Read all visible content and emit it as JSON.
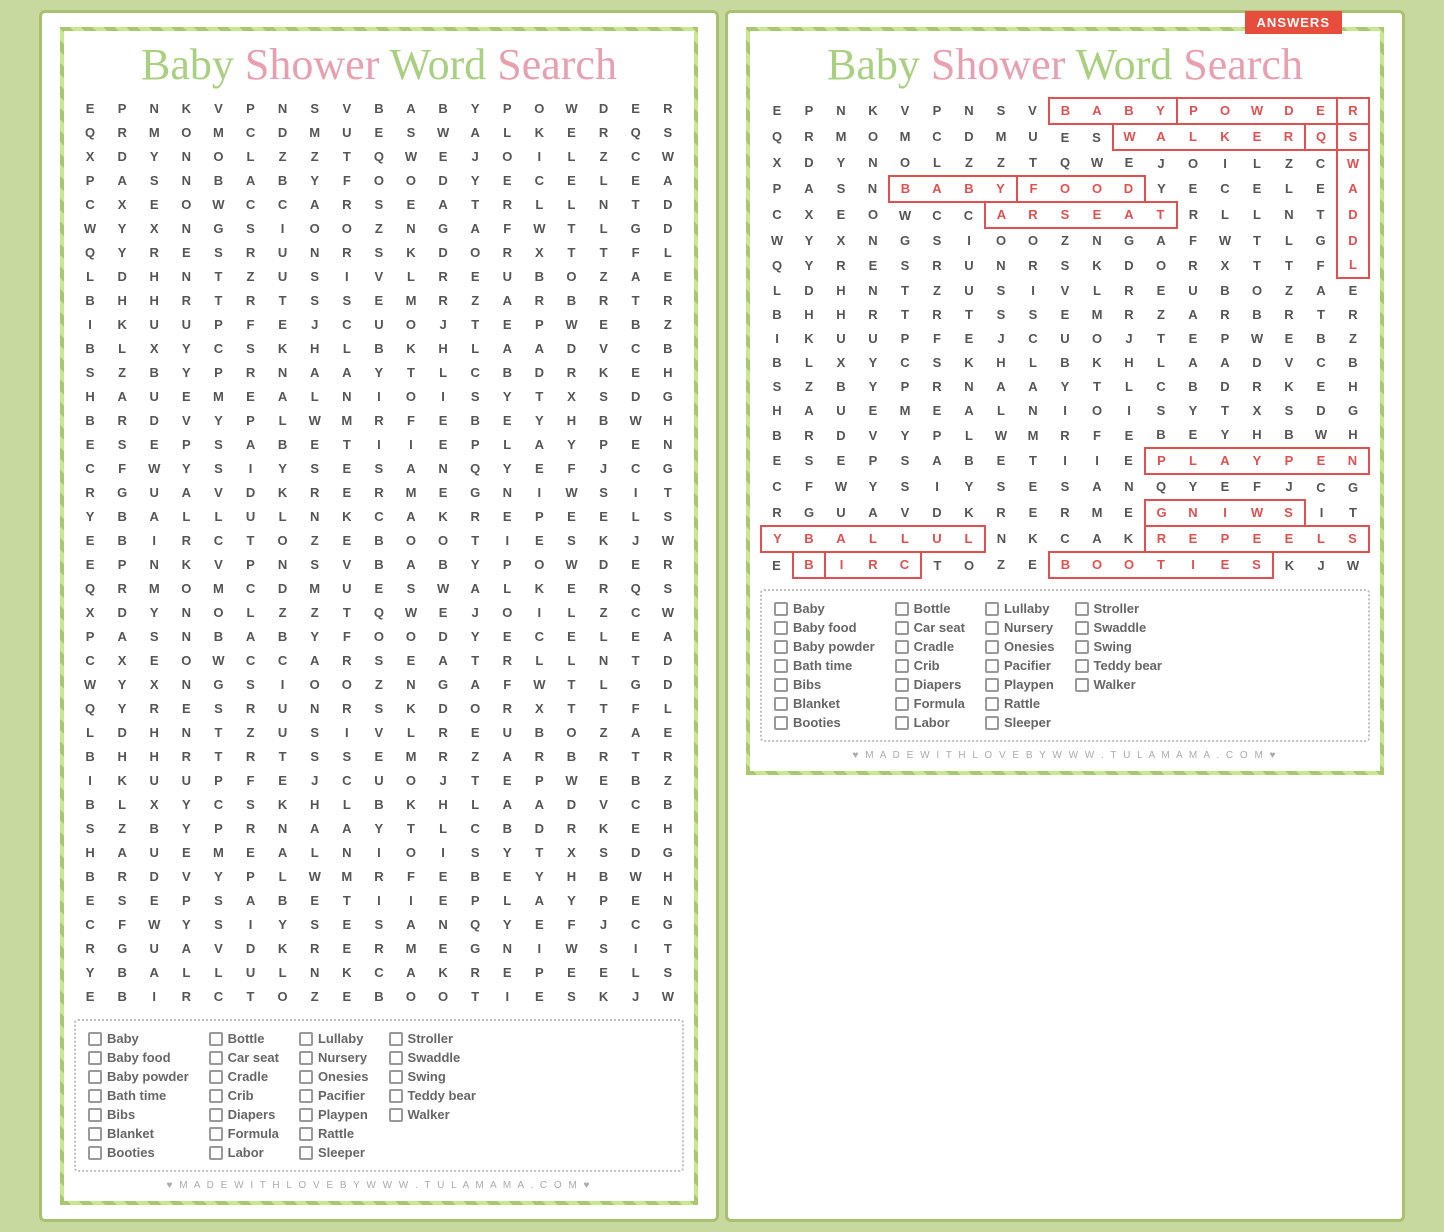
{
  "left_card": {
    "title": "Baby Shower Word Search",
    "footer": "♥  M A D E   W I T H   L O V E   B Y   W W W . T U L A M A M A . C O M  ♥",
    "grid": [
      [
        "E",
        "P",
        "N",
        "K",
        "V",
        "P",
        "N",
        "S",
        "V",
        "B",
        "A",
        "B",
        "Y",
        "P",
        "O",
        "W",
        "D",
        "E",
        "R"
      ],
      [
        "Q",
        "R",
        "M",
        "O",
        "M",
        "C",
        "D",
        "M",
        "U",
        "E",
        "S",
        "W",
        "A",
        "L",
        "K",
        "E",
        "R",
        "Q",
        "S"
      ],
      [
        "X",
        "D",
        "Y",
        "N",
        "O",
        "L",
        "Z",
        "Z",
        "T",
        "Q",
        "W",
        "E",
        "J",
        "O",
        "I",
        "L",
        "Z",
        "C",
        "W"
      ],
      [
        "P",
        "A",
        "S",
        "N",
        "B",
        "A",
        "B",
        "Y",
        "F",
        "O",
        "O",
        "D",
        "Y",
        "E",
        "C",
        "E",
        "L",
        "E",
        "A"
      ],
      [
        "C",
        "X",
        "E",
        "O",
        "W",
        "C",
        "C",
        "A",
        "R",
        "S",
        "E",
        "A",
        "T",
        "R",
        "L",
        "L",
        "N",
        "T",
        "D"
      ],
      [
        "W",
        "Y",
        "X",
        "N",
        "G",
        "S",
        "I",
        "O",
        "O",
        "Z",
        "N",
        "G",
        "A",
        "F",
        "W",
        "T",
        "L",
        "G",
        "D"
      ],
      [
        "Q",
        "Y",
        "R",
        "E",
        "S",
        "R",
        "U",
        "N",
        "R",
        "S",
        "K",
        "D",
        "O",
        "R",
        "X",
        "T",
        "T",
        "F",
        "L"
      ],
      [
        "L",
        "D",
        "H",
        "N",
        "T",
        "Z",
        "U",
        "S",
        "I",
        "V",
        "L",
        "R",
        "E",
        "U",
        "B",
        "O",
        "Z",
        "A",
        "E"
      ],
      [
        "B",
        "H",
        "H",
        "R",
        "T",
        "R",
        "T",
        "S",
        "S",
        "E",
        "M",
        "R",
        "Z",
        "A",
        "R",
        "B",
        "R",
        "T",
        "R"
      ],
      [
        "I",
        "K",
        "U",
        "U",
        "P",
        "F",
        "E",
        "J",
        "C",
        "U",
        "O",
        "J",
        "T",
        "E",
        "P",
        "W",
        "E",
        "B",
        "Z"
      ],
      [
        "B",
        "L",
        "X",
        "Y",
        "C",
        "S",
        "K",
        "H",
        "L",
        "B",
        "K",
        "H",
        "L",
        "A",
        "A",
        "D",
        "V",
        "C",
        "B"
      ],
      [
        "S",
        "Z",
        "B",
        "Y",
        "P",
        "R",
        "N",
        "A",
        "A",
        "Y",
        "T",
        "L",
        "C",
        "B",
        "D",
        "R",
        "K",
        "E",
        "H"
      ],
      [
        "H",
        "A",
        "U",
        "E",
        "M",
        "E",
        "A",
        "L",
        "N",
        "I",
        "O",
        "I",
        "S",
        "Y",
        "T",
        "X",
        "S",
        "D",
        "G"
      ],
      [
        "B",
        "R",
        "D",
        "V",
        "Y",
        "P",
        "L",
        "W",
        "M",
        "R",
        "F",
        "E",
        "B",
        "E",
        "Y",
        "H",
        "B",
        "W",
        "H"
      ],
      [
        "E",
        "S",
        "E",
        "P",
        "S",
        "A",
        "B",
        "E",
        "T",
        "I",
        "I",
        "E",
        "P",
        "L",
        "A",
        "Y",
        "P",
        "E",
        "N"
      ],
      [
        "C",
        "F",
        "W",
        "Y",
        "S",
        "I",
        "Y",
        "S",
        "E",
        "S",
        "A",
        "N",
        "Q",
        "Y",
        "E",
        "F",
        "J",
        "C",
        "G"
      ],
      [
        "R",
        "G",
        "U",
        "A",
        "V",
        "D",
        "K",
        "R",
        "E",
        "R",
        "M",
        "E",
        "G",
        "N",
        "I",
        "W",
        "S",
        "I",
        "T"
      ],
      [
        "Y",
        "B",
        "A",
        "L",
        "L",
        "U",
        "L",
        "N",
        "K",
        "C",
        "A",
        "K",
        "R",
        "E",
        "P",
        "E",
        "E",
        "L",
        "S"
      ],
      [
        "E",
        "B",
        "I",
        "R",
        "C",
        "T",
        "O",
        "Z",
        "E",
        "B",
        "O",
        "O",
        "T",
        "I",
        "E",
        "S",
        "K",
        "J",
        "W"
      ]
    ],
    "words": [
      [
        "Baby",
        "Bottle",
        "Lullaby",
        "Stroller"
      ],
      [
        "Baby food",
        "Car seat",
        "Nursery",
        "Swaddle"
      ],
      [
        "Baby powder",
        "Cradle",
        "Onesies",
        "Swing"
      ],
      [
        "Bath time",
        "Crib",
        "Pacifier",
        "Teddy bear"
      ],
      [
        "Bibs",
        "Diapers",
        "Playpen",
        "Walker"
      ],
      [
        "Blanket",
        "Formula",
        "Rattle",
        ""
      ],
      [
        "Booties",
        "Labor",
        "Sleeper",
        ""
      ]
    ]
  },
  "right_card": {
    "title": "Baby Shower Word Search",
    "answers_badge": "ANSWERS",
    "footer": "♥  M A D E   W I T H   L O V E   B Y   W W W . T U L A M A M A . C O M  ♥",
    "grid": [
      [
        "E",
        "P",
        "N",
        "K",
        "V",
        "P",
        "N",
        "S",
        "V",
        "B",
        "A",
        "B",
        "Y",
        "P",
        "O",
        "W",
        "D",
        "E",
        "R"
      ],
      [
        "Q",
        "R",
        "M",
        "O",
        "M",
        "C",
        "D",
        "M",
        "U",
        "E",
        "S",
        "W",
        "A",
        "L",
        "K",
        "E",
        "R",
        "Q",
        "S"
      ],
      [
        "X",
        "D",
        "Y",
        "N",
        "O",
        "L",
        "Z",
        "Z",
        "T",
        "Q",
        "W",
        "E",
        "J",
        "O",
        "I",
        "L",
        "Z",
        "C",
        "W"
      ],
      [
        "P",
        "A",
        "S",
        "N",
        "B",
        "A",
        "B",
        "Y",
        "F",
        "O",
        "O",
        "D",
        "Y",
        "E",
        "C",
        "E",
        "L",
        "E",
        "A"
      ],
      [
        "C",
        "X",
        "E",
        "O",
        "W",
        "C",
        "C",
        "A",
        "R",
        "S",
        "E",
        "A",
        "T",
        "R",
        "L",
        "L",
        "N",
        "T",
        "D"
      ],
      [
        "W",
        "Y",
        "X",
        "N",
        "G",
        "S",
        "I",
        "O",
        "O",
        "Z",
        "N",
        "G",
        "A",
        "F",
        "W",
        "T",
        "L",
        "G",
        "D"
      ],
      [
        "Q",
        "Y",
        "R",
        "E",
        "S",
        "R",
        "U",
        "N",
        "R",
        "S",
        "K",
        "D",
        "O",
        "R",
        "X",
        "T",
        "T",
        "F",
        "L"
      ],
      [
        "L",
        "D",
        "H",
        "N",
        "T",
        "Z",
        "U",
        "S",
        "I",
        "V",
        "L",
        "R",
        "E",
        "U",
        "B",
        "O",
        "Z",
        "A",
        "E"
      ],
      [
        "B",
        "H",
        "H",
        "R",
        "T",
        "R",
        "T",
        "S",
        "S",
        "E",
        "M",
        "R",
        "Z",
        "A",
        "R",
        "B",
        "R",
        "T",
        "R"
      ],
      [
        "I",
        "K",
        "U",
        "U",
        "P",
        "F",
        "E",
        "J",
        "C",
        "U",
        "O",
        "J",
        "T",
        "E",
        "P",
        "W",
        "E",
        "B",
        "Z"
      ],
      [
        "B",
        "L",
        "X",
        "Y",
        "C",
        "S",
        "K",
        "H",
        "L",
        "B",
        "K",
        "H",
        "L",
        "A",
        "A",
        "D",
        "V",
        "C",
        "B"
      ],
      [
        "S",
        "Z",
        "B",
        "Y",
        "P",
        "R",
        "N",
        "A",
        "A",
        "Y",
        "T",
        "L",
        "C",
        "B",
        "D",
        "R",
        "K",
        "E",
        "H"
      ],
      [
        "H",
        "A",
        "U",
        "E",
        "M",
        "E",
        "A",
        "L",
        "N",
        "I",
        "O",
        "I",
        "S",
        "Y",
        "T",
        "X",
        "S",
        "D",
        "G"
      ],
      [
        "B",
        "R",
        "D",
        "V",
        "Y",
        "P",
        "L",
        "W",
        "M",
        "R",
        "F",
        "E",
        "B",
        "E",
        "Y",
        "H",
        "B",
        "W",
        "H"
      ],
      [
        "E",
        "S",
        "E",
        "P",
        "S",
        "A",
        "B",
        "E",
        "T",
        "I",
        "I",
        "E",
        "P",
        "L",
        "A",
        "Y",
        "P",
        "E",
        "N"
      ],
      [
        "C",
        "F",
        "W",
        "Y",
        "S",
        "I",
        "Y",
        "S",
        "E",
        "S",
        "A",
        "N",
        "Q",
        "Y",
        "E",
        "F",
        "J",
        "C",
        "G"
      ],
      [
        "R",
        "G",
        "U",
        "A",
        "V",
        "D",
        "K",
        "R",
        "E",
        "R",
        "M",
        "E",
        "G",
        "N",
        "I",
        "W",
        "S",
        "I",
        "T"
      ],
      [
        "Y",
        "B",
        "A",
        "L",
        "L",
        "U",
        "L",
        "N",
        "K",
        "C",
        "A",
        "K",
        "R",
        "E",
        "P",
        "E",
        "E",
        "L",
        "S"
      ],
      [
        "E",
        "B",
        "I",
        "R",
        "C",
        "T",
        "O",
        "Z",
        "E",
        "B",
        "O",
        "O",
        "T",
        "I",
        "E",
        "S",
        "K",
        "J",
        "W"
      ]
    ],
    "words": [
      [
        "Baby",
        "Bottle",
        "Lullaby",
        "Stroller"
      ],
      [
        "Baby food",
        "Car seat",
        "Nursery",
        "Swaddle"
      ],
      [
        "Baby powder",
        "Cradle",
        "Onesies",
        "Swing"
      ],
      [
        "Bath time",
        "Crib",
        "Pacifier",
        "Teddy bear"
      ],
      [
        "Bibs",
        "Diapers",
        "Playpen",
        "Walker"
      ],
      [
        "Blanket",
        "Formula",
        "Rattle",
        ""
      ],
      [
        "Booties",
        "Labor",
        "Sleeper",
        ""
      ]
    ]
  }
}
